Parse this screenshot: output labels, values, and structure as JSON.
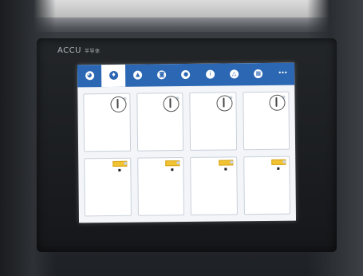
{
  "monitor": {
    "brand": "ACCU",
    "brand_sub": "半导体"
  },
  "nav": {
    "tabs": [
      {
        "label": "",
        "icon": "face-icon",
        "glyph": "◕",
        "active": false
      },
      {
        "label": "",
        "icon": "shield-icon",
        "glyph": "♦",
        "active": true
      },
      {
        "label": "",
        "icon": "alarm-icon",
        "glyph": "▲",
        "active": false
      },
      {
        "label": "",
        "icon": "car-icon",
        "glyph": "◙",
        "active": false
      },
      {
        "label": "",
        "icon": "badge-icon",
        "glyph": "●",
        "active": false
      },
      {
        "label": "",
        "icon": "info-icon",
        "glyph": "i",
        "active": false
      },
      {
        "label": "",
        "icon": "warning-icon",
        "glyph": "△",
        "active": false
      },
      {
        "label": "",
        "icon": "calendar-icon",
        "glyph": "▦",
        "active": false
      },
      {
        "label": "",
        "icon": "more-icon",
        "glyph": "•••",
        "active": false
      }
    ]
  },
  "cards": {
    "row1": [
      {
        "kind": "dial"
      },
      {
        "kind": "dial"
      },
      {
        "kind": "dial"
      },
      {
        "kind": "dial"
      }
    ],
    "row2": [
      {
        "kind": "bar"
      },
      {
        "kind": "bar"
      },
      {
        "kind": "bar"
      },
      {
        "kind": "bar"
      }
    ]
  }
}
